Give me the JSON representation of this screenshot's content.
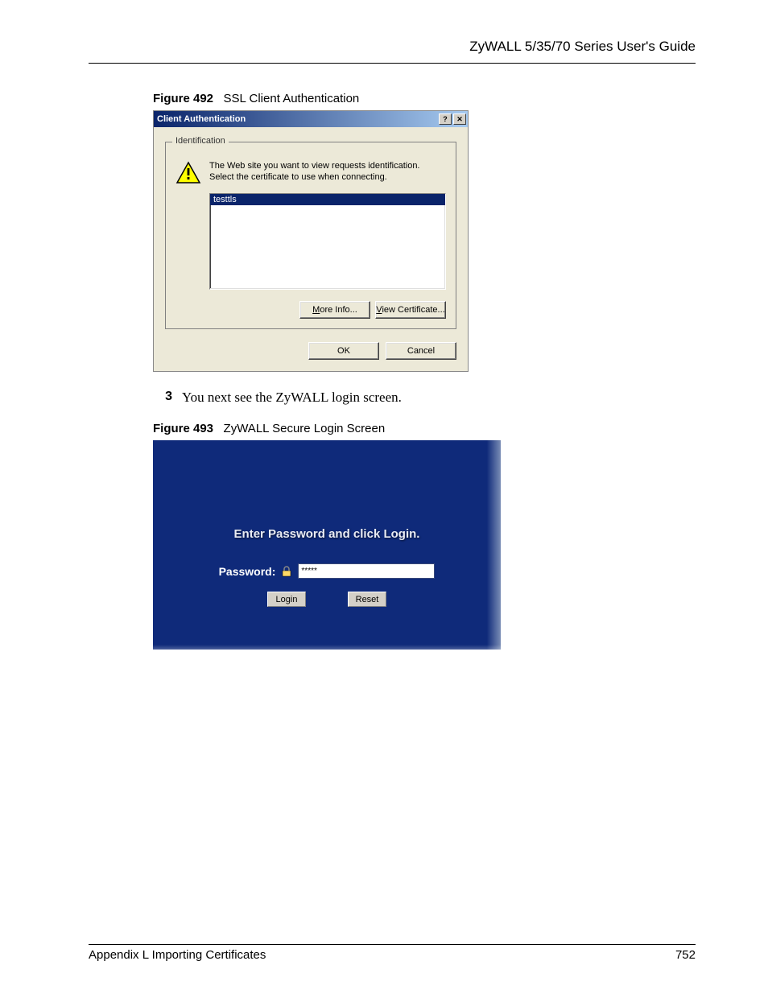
{
  "header": {
    "guide_title": "ZyWALL 5/35/70 Series User's Guide"
  },
  "figures": {
    "fig492": {
      "label": "Figure 492",
      "title": "SSL Client Authentication"
    },
    "fig493": {
      "label": "Figure 493",
      "title": "ZyWALL Secure Login Screen"
    }
  },
  "dialog": {
    "title": "Client Authentication",
    "help_glyph": "?",
    "close_glyph": "✕",
    "group_legend": "Identification",
    "message": "The Web site you want to view requests identification. Select the certificate to use when connecting.",
    "cert_item": "testtls",
    "more_info_prefix": "M",
    "more_info_rest": "ore Info...",
    "view_cert_prefix": "V",
    "view_cert_rest": "iew Certificate...",
    "ok": "OK",
    "cancel": "Cancel"
  },
  "step": {
    "num": "3",
    "text": "You next see the ZyWALL login screen."
  },
  "login": {
    "title": "Enter Password and click Login.",
    "pwd_label": "Password:",
    "pwd_masked": "*****",
    "login_btn": "Login",
    "reset_btn": "Reset"
  },
  "footer": {
    "appendix": "Appendix L Importing Certificates",
    "page": "752"
  }
}
